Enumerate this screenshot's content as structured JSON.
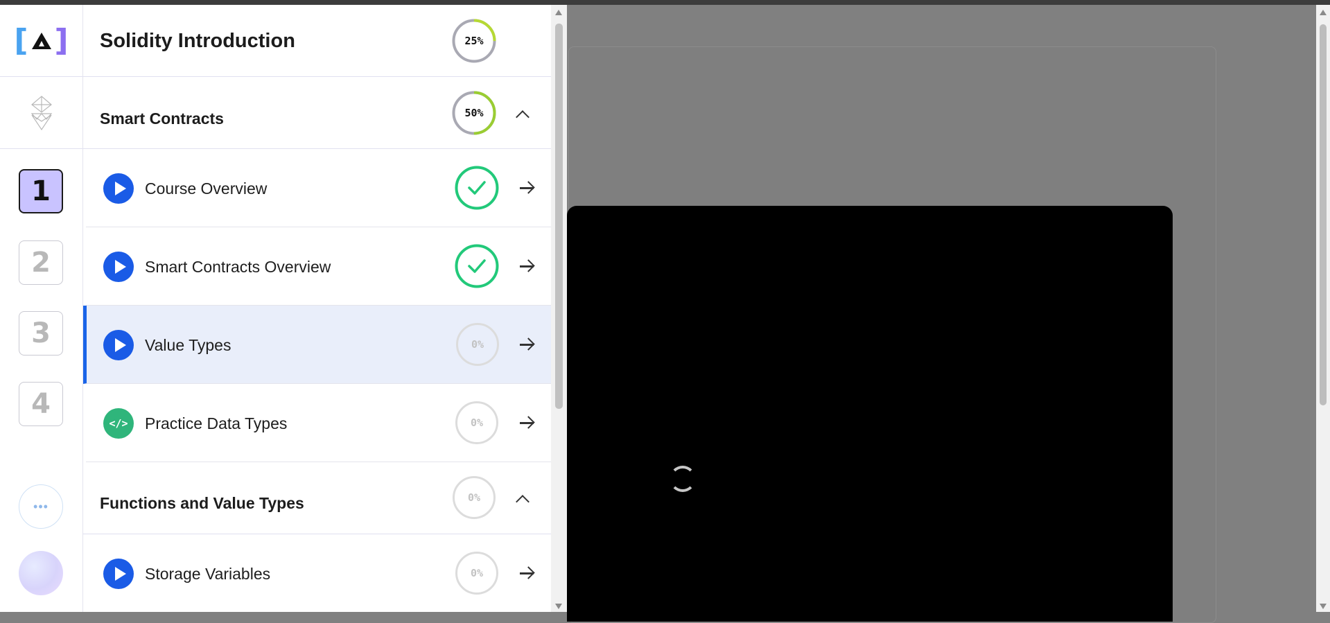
{
  "course": {
    "title": "Solidity Introduction",
    "progress_label": "25%",
    "progress": 0.25
  },
  "rail": {
    "sections": [
      "1",
      "2",
      "3",
      "4"
    ],
    "active_section": 0,
    "more_label": "•••"
  },
  "sections": [
    {
      "title": "Smart Contracts",
      "progress_label": "50%",
      "progress": 0.5,
      "lessons": [
        {
          "label": "Course Overview",
          "type": "video",
          "status": "complete"
        },
        {
          "label": "Smart Contracts Overview",
          "type": "video",
          "status": "complete"
        },
        {
          "label": "Value Types",
          "type": "video",
          "status": "in-progress",
          "progress_label": "0%",
          "active": true
        },
        {
          "label": "Practice Data Types",
          "type": "code",
          "status": "not-started",
          "progress_label": "0%"
        }
      ]
    },
    {
      "title": "Functions and Value Types",
      "progress_label": "0%",
      "progress": 0,
      "lessons": [
        {
          "label": "Storage Variables",
          "type": "video",
          "status": "not-started",
          "progress_label": "0%"
        }
      ]
    }
  ],
  "icons": {
    "play": "play-icon",
    "code": "code-icon",
    "check": "check-icon",
    "arrow": "arrow-right-icon",
    "chevron": "chevron-up-icon",
    "code_glyph": "</>"
  },
  "colors": {
    "accent_blue": "#1a5be6",
    "complete_green": "#22c97a",
    "code_green": "#2fb57b",
    "active_row_bg": "#e9eefa",
    "active_section_bg": "#c9c3ff",
    "ring_track": "#a9a9b3",
    "ring_progress": "#9acd32"
  }
}
